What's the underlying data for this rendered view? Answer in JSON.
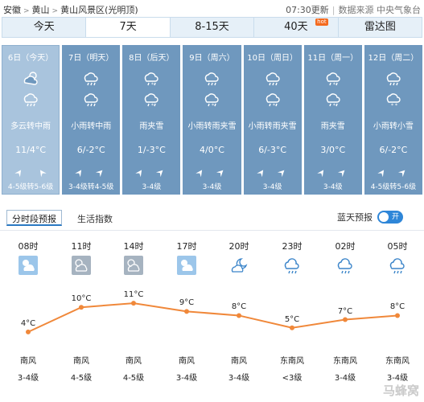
{
  "breadcrumb": [
    "安徽",
    "黄山",
    "黄山风景区(光明顶)"
  ],
  "updated": {
    "time": "07:30更新",
    "source": "数据来源 中央气象台"
  },
  "tabs": [
    {
      "label": "今天",
      "active": false
    },
    {
      "label": "7天",
      "active": true
    },
    {
      "label": "8-15天",
      "active": false
    },
    {
      "label": "40天",
      "active": false,
      "badge": "hot"
    },
    {
      "label": "雷达图",
      "active": false
    }
  ],
  "days": [
    {
      "date": "6日（今天）",
      "icons": [
        "partly-cloudy-icon",
        "rain-icon"
      ],
      "cond": "多云转中雨",
      "temp": "11/4°C",
      "wind": "4-5级转5-6级",
      "today": true
    },
    {
      "date": "7日（明天）",
      "icons": [
        "rain-icon",
        "rain-icon"
      ],
      "cond": "小雨转中雨",
      "temp": "6/-2°C",
      "wind": "3-4级转4-5级",
      "today": false
    },
    {
      "date": "8日（后天）",
      "icons": [
        "sleet-icon",
        "sleet-icon"
      ],
      "cond": "雨夹雪",
      "temp": "1/-3°C",
      "wind": "3-4级",
      "today": false
    },
    {
      "date": "9日（周六）",
      "icons": [
        "rain-icon",
        "sleet-icon"
      ],
      "cond": "小雨转雨夹雪",
      "temp": "4/0°C",
      "wind": "3-4级",
      "today": false
    },
    {
      "date": "10日（周日）",
      "icons": [
        "rain-icon",
        "sleet-icon"
      ],
      "cond": "小雨转雨夹雪",
      "temp": "6/-3°C",
      "wind": "3-4级",
      "today": false
    },
    {
      "date": "11日（周一）",
      "icons": [
        "sleet-icon",
        "sleet-icon"
      ],
      "cond": "雨夹雪",
      "temp": "3/0°C",
      "wind": "3-4级",
      "today": false
    },
    {
      "date": "12日（周二）",
      "icons": [
        "rain-icon",
        "snow-icon"
      ],
      "cond": "小雨转小雪",
      "temp": "6/-2°C",
      "wind": "4-5级转5-6级",
      "today": false
    }
  ],
  "subnav": {
    "hourly": "分时段预报",
    "index": "生活指数",
    "toggle_label": "蓝天预报",
    "toggle_state": "开"
  },
  "hours": [
    {
      "time": "08时",
      "icon": "partly-cloudy-day-icon",
      "temp_label": "4°C",
      "dir": "南风",
      "level": "3-4级"
    },
    {
      "time": "11时",
      "icon": "cloudy-day-icon",
      "temp_label": "10°C",
      "dir": "南风",
      "level": "4-5级"
    },
    {
      "time": "14时",
      "icon": "cloudy-day-icon",
      "temp_label": "11°C",
      "dir": "南风",
      "level": "4-5级"
    },
    {
      "time": "17时",
      "icon": "partly-cloudy-day-icon",
      "temp_label": "9°C",
      "dir": "南风",
      "level": "3-4级"
    },
    {
      "time": "20时",
      "icon": "cloudy-night-icon",
      "temp_label": "8°C",
      "dir": "南风",
      "level": "3-4级"
    },
    {
      "time": "23时",
      "icon": "rain-icon",
      "temp_label": "5°C",
      "dir": "东南风",
      "level": "<3级"
    },
    {
      "time": "02时",
      "icon": "rain-icon",
      "temp_label": "7°C",
      "dir": "东南风",
      "level": "3-4级"
    },
    {
      "time": "05时",
      "icon": "rain-icon",
      "temp_label": "8°C",
      "dir": "东南风",
      "level": "3-4级"
    }
  ],
  "chart_data": {
    "type": "line",
    "x": [
      "08时",
      "11时",
      "14时",
      "17时",
      "20时",
      "23时",
      "02时",
      "05时"
    ],
    "values": [
      4,
      10,
      11,
      9,
      8,
      5,
      7,
      8
    ],
    "ylim": [
      3,
      12
    ]
  },
  "colors": {
    "day_bg": "#6f98be",
    "today_bg": "#a9c4dd",
    "line": "#f0883a",
    "accent": "#2e86d8"
  },
  "watermark": "马蜂窝"
}
